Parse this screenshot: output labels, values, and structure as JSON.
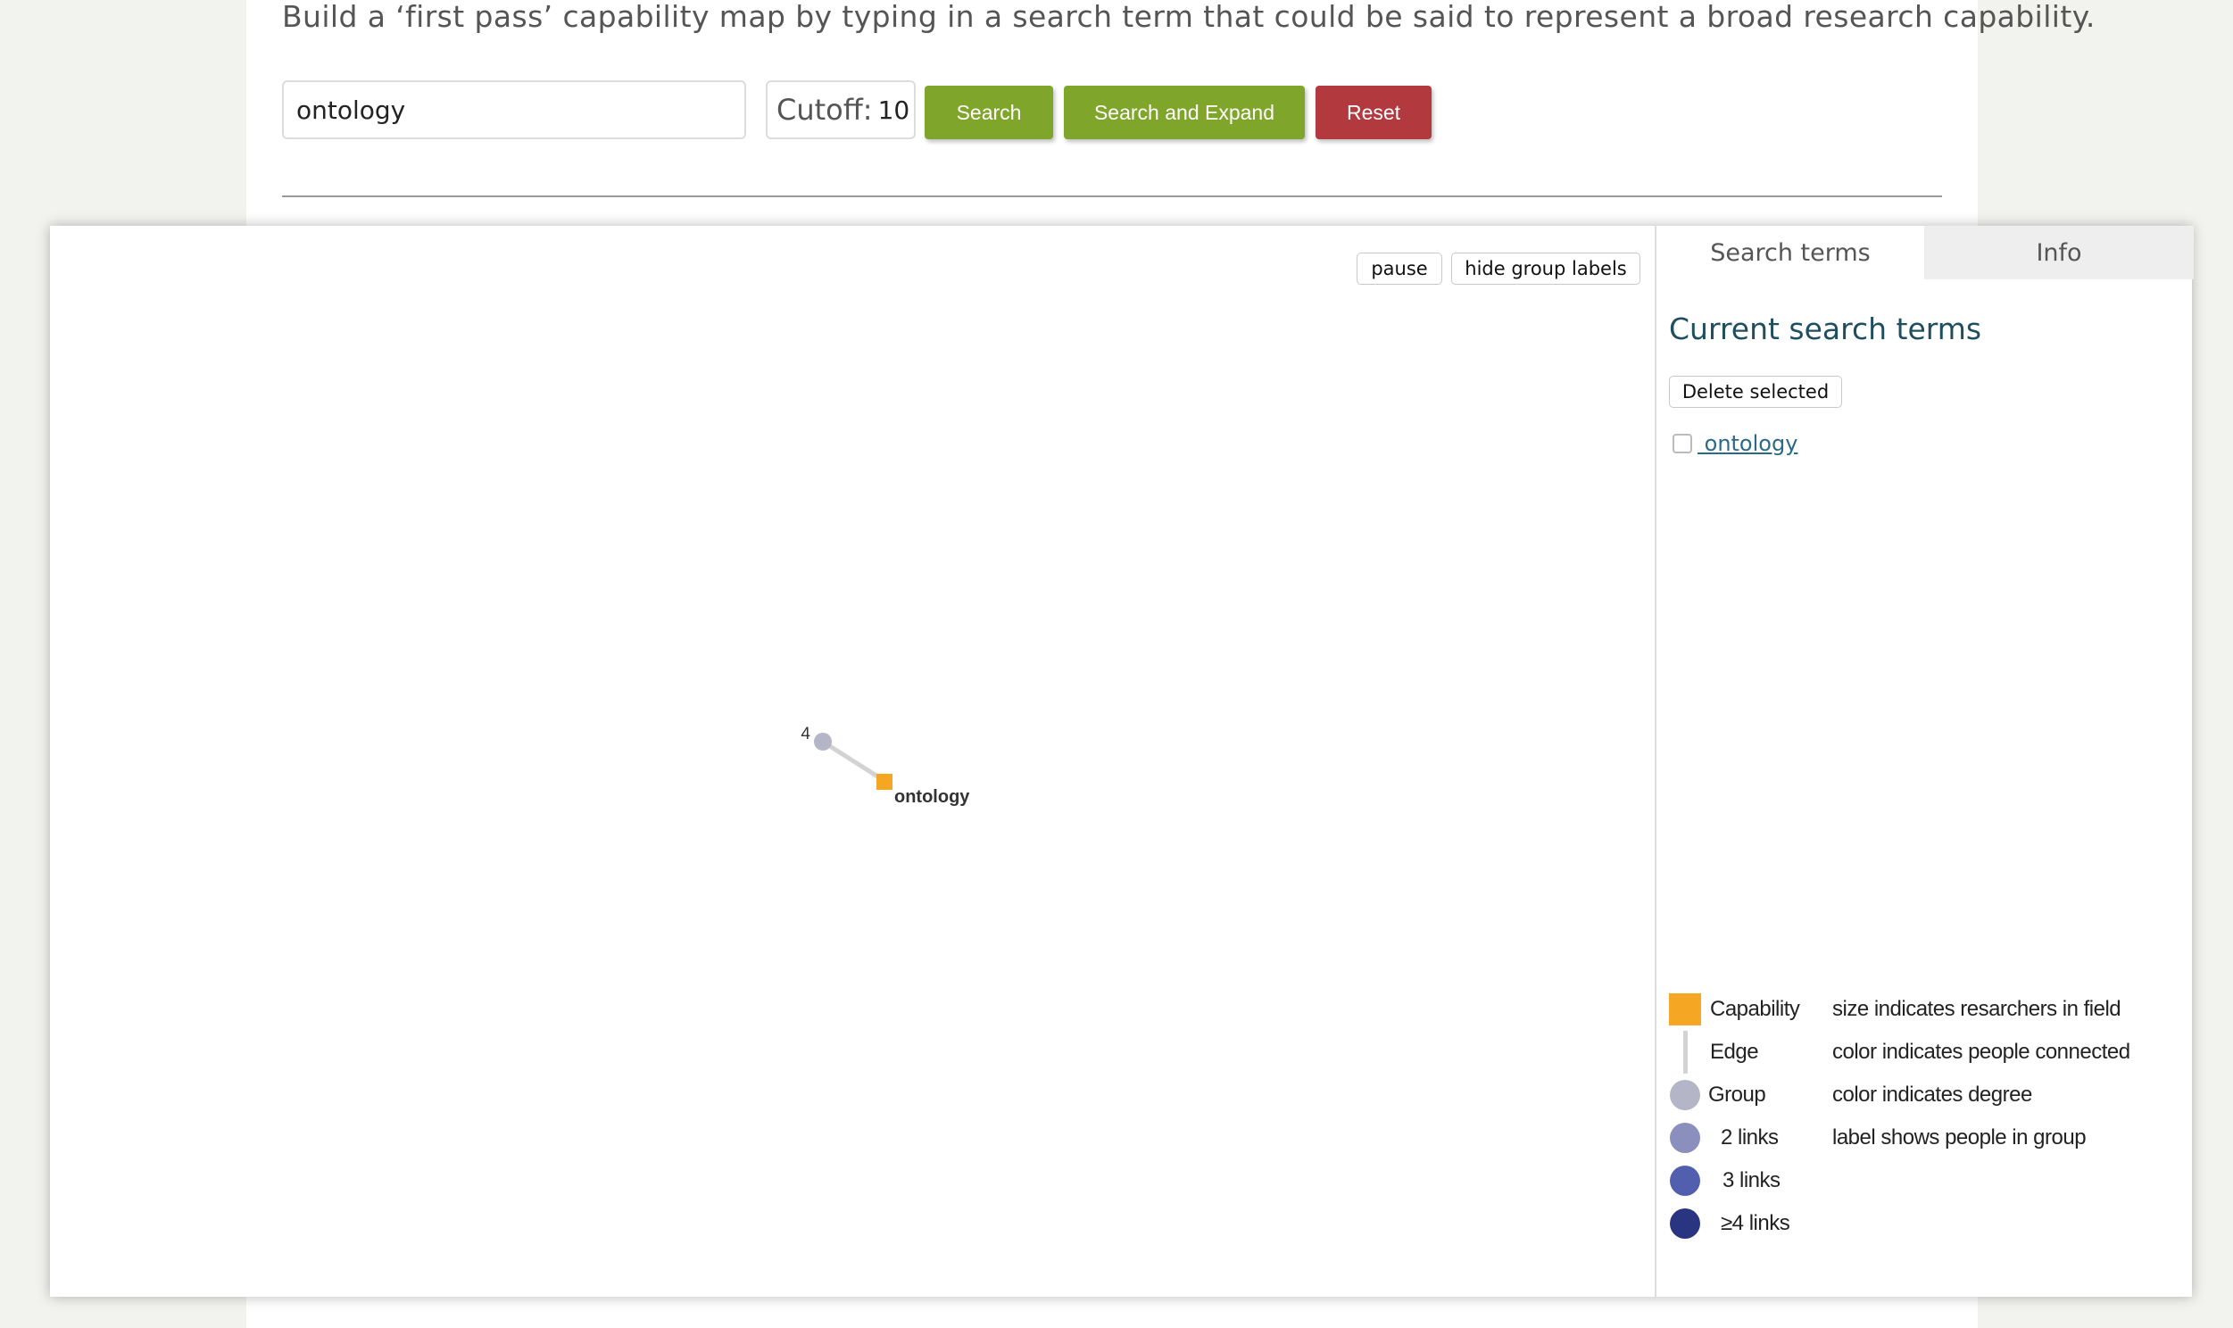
{
  "intro_text": "Build a ‘first pass’ capability map by typing in a search term that could be said to represent a broad research capability.",
  "search": {
    "value": "ontology",
    "cutoff_label": "Cutoff:",
    "cutoff_value": "10"
  },
  "buttons": {
    "search": "Search",
    "search_expand": "Search and Expand",
    "reset": "Reset"
  },
  "graph": {
    "controls": {
      "pause": "pause",
      "hide_group_labels": "hide group labels"
    },
    "nodes": [
      {
        "type": "group",
        "label": "4"
      },
      {
        "type": "capability",
        "label": "ontology"
      }
    ],
    "colors": {
      "capability": "#f5a623",
      "edge": "#d3d3d3",
      "group": "#b5b5c8"
    }
  },
  "sidebar": {
    "tabs": [
      "Search terms",
      "Info"
    ],
    "title": "Current search terms",
    "delete_button": "Delete selected",
    "terms": [
      {
        "label": " ontology",
        "checked": false
      }
    ]
  },
  "legend": {
    "items": [
      {
        "symbol": "capability-square",
        "color": "#f5a623",
        "label": "Capability",
        "desc": "size indicates resarchers in field"
      },
      {
        "symbol": "edge-line",
        "color": "#d3d3d3",
        "label": "Edge",
        "desc": "color indicates people connected"
      },
      {
        "symbol": "group-circle",
        "color": "#b5b5c8",
        "label": "Group",
        "desc": "color indicates degree"
      },
      {
        "symbol": "group-circle",
        "color": "#8a8fbd",
        "label": "2 links",
        "desc": "label shows people in group"
      },
      {
        "symbol": "group-circle",
        "color": "#525fae",
        "label": "3 links",
        "desc": ""
      },
      {
        "symbol": "group-circle",
        "color": "#2a3582",
        "label": "≥4 links",
        "desc": ""
      }
    ]
  }
}
